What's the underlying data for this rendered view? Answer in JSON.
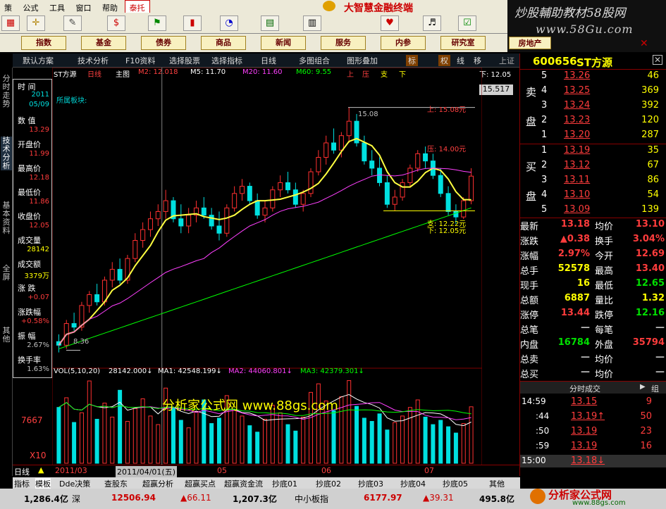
{
  "menu": [
    "策",
    "公式",
    "工具",
    "窗口",
    "帮助",
    "泰托"
  ],
  "title": "大智慧金融终端",
  "banner": {
    "line1": "炒股輔助教材58股网",
    "line2": "www.58Gu.com"
  },
  "nav": [
    "指数",
    "基金",
    "债券",
    "商品",
    "新闻",
    "服务",
    "内参",
    "研究室"
  ],
  "nav_right": "房地产",
  "section": {
    "tabs": [
      "默认方案",
      "技术分析",
      "F10资料",
      "选择股票",
      "选择指标",
      "日线",
      "多图组合",
      "图形叠加",
      "标",
      "权",
      "线",
      "移"
    ],
    "shangzheng": "上证"
  },
  "vtabs": [
    "分时走势",
    "技术分析",
    "基本资料",
    "全屏",
    "其他"
  ],
  "chart_header": {
    "name": "ST方源",
    "period": "日线",
    "main": "主图",
    "m2": "M2: 12.018",
    "m5": "M5: 11.70",
    "m20": "M20: 11.60",
    "m60": "M60: 9.55",
    "shang": "上",
    "ya": "压",
    "zhi": "支",
    "xia": "下",
    "right": "下: 12.05",
    "block": "所属板块:",
    "price_box": "15.517"
  },
  "info": [
    {
      "label": "时 间",
      "v1": "2011",
      "v2": "05/09"
    },
    {
      "label": "数 值",
      "v": "13.29"
    },
    {
      "label": "开盘价",
      "v": "11.99"
    },
    {
      "label": "最高价",
      "v": "12.18"
    },
    {
      "label": "最低价",
      "v": "11.86"
    },
    {
      "label": "收盘价",
      "v": "12.05"
    },
    {
      "label": "成交量",
      "v": "28142"
    },
    {
      "label": "成交额",
      "v": "3379万"
    },
    {
      "label": "涨 跌",
      "v": "+0.07"
    },
    {
      "label": "涨跌幅",
      "v": "+0.58%"
    },
    {
      "label": "振 幅",
      "v": "2.67%"
    },
    {
      "label": "换手率",
      "v": "1.63%"
    }
  ],
  "annotations": {
    "high": "15.08",
    "shang": "上: 15.08元",
    "ya": "压: 14.00元",
    "zhi": "支: 12.22元",
    "xia": "下: 12.05元",
    "low": "8.36"
  },
  "vol_header": {
    "vol": "VOL(5,10,20)",
    "v": "28142.000↓",
    "ma1": "MA1: 42548.199↓",
    "ma2": "MA2: 44060.801↓",
    "ma3": "MA3: 42379.301↓"
  },
  "watermark": "分析家公式网 www.88gs.com",
  "vol_axis": [
    "7667",
    "X10"
  ],
  "date_axis": [
    "2011/03",
    "2011/04/01(五)",
    "05",
    "06",
    "07"
  ],
  "period_label": "日线",
  "stock": {
    "code": "600656",
    "name": "ST方源"
  },
  "sell": [
    {
      "n": "5",
      "p": "13.26",
      "v": "46"
    },
    {
      "n": "4",
      "p": "13.25",
      "v": "369"
    },
    {
      "n": "3",
      "p": "13.24",
      "v": "392"
    },
    {
      "n": "2",
      "p": "13.23",
      "v": "120"
    },
    {
      "n": "1",
      "p": "13.20",
      "v": "287"
    }
  ],
  "buy": [
    {
      "n": "1",
      "p": "13.19",
      "v": "35"
    },
    {
      "n": "2",
      "p": "13.12",
      "v": "67"
    },
    {
      "n": "3",
      "p": "13.11",
      "v": "86"
    },
    {
      "n": "4",
      "p": "13.10",
      "v": "54"
    },
    {
      "n": "5",
      "p": "13.09",
      "v": "139"
    }
  ],
  "sell_label": [
    "卖",
    "盘"
  ],
  "buy_label": [
    "买",
    "盘"
  ],
  "quote": [
    [
      "最新",
      "13.18",
      "均价",
      "13.10"
    ],
    [
      "涨跌",
      "▲0.38",
      "换手",
      "3.04%"
    ],
    [
      "涨幅",
      "2.97%",
      "今开",
      "12.69"
    ],
    [
      "总手",
      "52578",
      "最高",
      "13.40"
    ],
    [
      "现手",
      "16",
      "最低",
      "12.65"
    ],
    [
      "总额",
      "6887",
      "量比",
      "1.32"
    ],
    [
      "涨停",
      "13.44",
      "跌停",
      "12.16"
    ],
    [
      "总笔",
      "—",
      "每笔",
      "—"
    ],
    [
      "内盘",
      "16784",
      "外盘",
      "35794"
    ],
    [
      "总卖",
      "—",
      "均价",
      "—"
    ],
    [
      "总买",
      "—",
      "均价",
      "—"
    ]
  ],
  "tick_header": "分时成交",
  "tick_toggle": "组",
  "ticks": [
    [
      "14:59",
      "13.15",
      "9"
    ],
    [
      ":44",
      "13.19↑",
      "50"
    ],
    [
      ":50",
      "13.19",
      "23"
    ],
    [
      ":59",
      "13.19",
      "16"
    ],
    [
      "15:00",
      "13.18↓",
      ""
    ]
  ],
  "bottom_tabs": [
    "指标",
    "模板",
    "Dde决策",
    "查股东",
    "超赢分析",
    "超赢买点",
    "超赢资金流",
    "抄底01",
    "抄底02",
    "抄底03",
    "抄底04",
    "抄底05",
    "其他"
  ],
  "status": [
    "1,286.4亿",
    "深",
    "12506.94",
    "▲66.11",
    "1,207.3亿",
    "中小板指",
    "6177.97",
    "▲39.31",
    "495.8亿"
  ],
  "status_logo": "分析家公式网",
  "status_url": "www.88gs.com",
  "chart_data": {
    "type": "candlestick",
    "title": "ST方源 日线",
    "ylim": [
      8.0,
      15.6
    ],
    "candles": [
      [
        8.6,
        8.8,
        8.3,
        8.5
      ],
      [
        8.5,
        9.2,
        8.4,
        9.1
      ],
      [
        9.1,
        9.4,
        8.9,
        9.0
      ],
      [
        9.0,
        9.7,
        8.9,
        9.6
      ],
      [
        9.6,
        10.0,
        9.4,
        9.9
      ],
      [
        9.9,
        10.2,
        9.6,
        9.7
      ],
      [
        9.7,
        10.4,
        9.6,
        10.3
      ],
      [
        10.3,
        10.8,
        10.1,
        10.6
      ],
      [
        10.6,
        10.9,
        10.2,
        10.3
      ],
      [
        10.3,
        11.0,
        10.2,
        10.9
      ],
      [
        10.9,
        11.6,
        10.8,
        11.4
      ],
      [
        11.4,
        11.9,
        11.2,
        11.7
      ],
      [
        11.7,
        12.2,
        11.5,
        12.0
      ],
      [
        12.0,
        12.4,
        11.8,
        12.2
      ],
      [
        12.2,
        12.8,
        12.0,
        12.5
      ],
      [
        12.5,
        12.6,
        11.9,
        12.0
      ],
      [
        12.0,
        12.4,
        11.6,
        11.8
      ],
      [
        11.8,
        12.3,
        11.6,
        12.1
      ],
      [
        12.1,
        12.5,
        11.9,
        12.3
      ],
      [
        12.3,
        12.6,
        12.0,
        12.1
      ],
      [
        12.1,
        12.3,
        11.7,
        11.8
      ],
      [
        11.8,
        12.2,
        11.4,
        11.6
      ],
      [
        11.6,
        12.4,
        11.5,
        12.3
      ],
      [
        12.3,
        12.9,
        12.2,
        12.7
      ],
      [
        12.7,
        13.1,
        12.5,
        12.9
      ],
      [
        12.9,
        13.0,
        12.4,
        12.5
      ],
      [
        12.5,
        12.7,
        12.0,
        12.1
      ],
      [
        12.1,
        12.5,
        11.9,
        12.3
      ],
      [
        12.3,
        12.9,
        12.2,
        12.8
      ],
      [
        12.8,
        13.2,
        12.6,
        13.0
      ],
      [
        13.0,
        13.3,
        12.7,
        12.8
      ],
      [
        12.8,
        13.0,
        12.3,
        12.4
      ],
      [
        12.4,
        12.8,
        12.2,
        12.7
      ],
      [
        12.7,
        13.4,
        12.6,
        13.3
      ],
      [
        13.3,
        13.9,
        13.2,
        13.7
      ],
      [
        13.7,
        14.3,
        13.5,
        14.1
      ],
      [
        14.1,
        14.5,
        13.8,
        13.9
      ],
      [
        13.9,
        14.4,
        13.7,
        14.3
      ],
      [
        14.3,
        15.08,
        14.1,
        14.7
      ],
      [
        14.7,
        14.9,
        14.0,
        14.1
      ],
      [
        14.1,
        14.3,
        13.5,
        13.6
      ],
      [
        13.6,
        13.9,
        13.2,
        13.4
      ],
      [
        13.4,
        13.7,
        12.9,
        13.0
      ],
      [
        13.0,
        13.2,
        12.3,
        12.4
      ],
      [
        12.4,
        12.8,
        12.22,
        12.6
      ],
      [
        12.6,
        13.1,
        12.5,
        13.0
      ],
      [
        13.0,
        13.5,
        12.9,
        13.4
      ],
      [
        13.4,
        13.9,
        13.3,
        13.8
      ],
      [
        13.8,
        14.0,
        13.4,
        13.6
      ],
      [
        13.6,
        13.8,
        13.1,
        13.2
      ],
      [
        13.2,
        13.4,
        12.6,
        12.7
      ],
      [
        12.7,
        12.9,
        12.1,
        12.2
      ],
      [
        12.2,
        12.4,
        11.86,
        12.05
      ],
      [
        12.05,
        12.6,
        11.99,
        12.5
      ],
      [
        12.5,
        13.4,
        12.4,
        13.18
      ]
    ],
    "vol": [
      5200,
      6100,
      3800,
      4700,
      7667,
      4100,
      5600,
      4300,
      6800,
      3900,
      5100,
      6000,
      4400,
      3600,
      7000,
      5200,
      4000,
      3300,
      4800,
      5900,
      3700,
      4200,
      6300,
      5000,
      4400,
      3500,
      2900,
      4100,
      5400,
      4700,
      3600,
      3000,
      4300,
      6600,
      7400,
      5800,
      4900,
      6200,
      7700,
      5300,
      4200,
      3900,
      4600,
      3100,
      3800,
      4400,
      5200,
      5900,
      4300,
      3600,
      4000,
      3400,
      2814,
      3700,
      5258
    ]
  }
}
